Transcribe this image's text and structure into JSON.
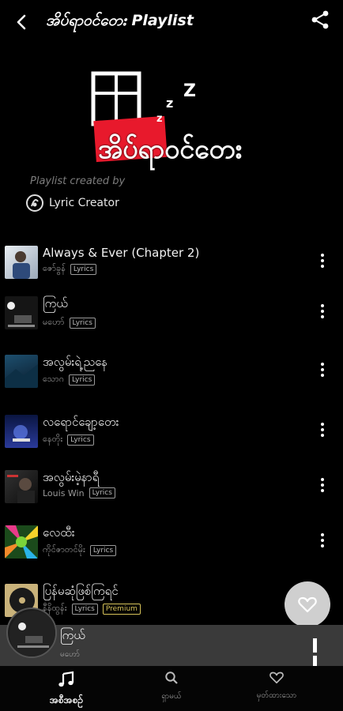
{
  "header": {
    "title": "အိပ်ရာဝင်တေး Playlist"
  },
  "cover": {
    "caption": "အိပ်ရာဝင်တေး",
    "zzz": "z z Z"
  },
  "creator": {
    "created_by": "Playlist created by",
    "name": "Lyric Creator"
  },
  "songs": [
    {
      "title": "Always & Ever (Chapter 2)",
      "artist": "ဇော်ခွန်",
      "badges": [
        "Lyrics"
      ]
    },
    {
      "title": "ကြယ်",
      "artist": "မဟော်",
      "badges": [
        "Lyrics"
      ]
    },
    {
      "title": "အလွမ်းရဲ့ညနေ",
      "artist": "သောဂ",
      "badges": [
        "Lyrics"
      ]
    },
    {
      "title": "လရောင်ချော့တေး",
      "artist": "နေတိုး",
      "badges": [
        "Lyrics"
      ]
    },
    {
      "title": "အလွမ်းမဲ့နာရီ",
      "artist": "Louis Win",
      "badges": [
        "Lyrics"
      ]
    },
    {
      "title": "လေထီး",
      "artist": "ကိုင်ဇာတင်မိုး",
      "badges": [
        "Lyrics"
      ]
    },
    {
      "title": "ပြန်မဆုံဖြစ်ကြရင်",
      "artist": "နီနိထွန်း",
      "badges": [
        "Lyrics",
        "Premium"
      ]
    }
  ],
  "now_playing": {
    "title": "ကြယ်",
    "artist": "မဟော်"
  },
  "nav": [
    {
      "label": "အစီအစဉ်",
      "icon": "music-note-icon",
      "active": true
    },
    {
      "label": "ရှာမယ်",
      "icon": "search-icon",
      "active": false
    },
    {
      "label": "မှတ်ထားသော",
      "icon": "heart-outline-icon",
      "active": false
    }
  ],
  "colors": {
    "background": "#000000",
    "mini_player": "#3a3a3a",
    "premium": "#d8c45a",
    "cover_red": "#e8192c"
  }
}
